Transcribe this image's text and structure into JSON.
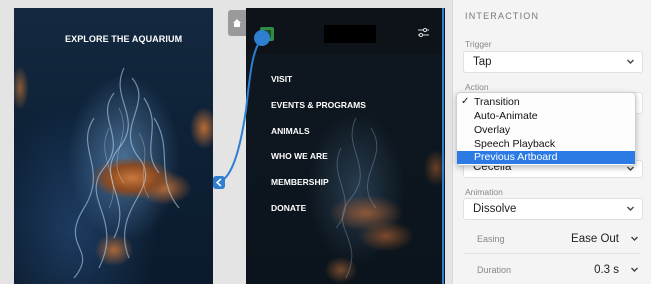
{
  "canvas": {
    "left_artboard": {
      "title": "EXPLORE THE AQUARIUM"
    },
    "right_artboard": {
      "menu": [
        "VISIT",
        "EVENTS & PROGRAMS",
        "ANIMALS",
        "WHO WE ARE",
        "MEMBERSHIP",
        "DONATE"
      ]
    },
    "home_icon": "home-icon",
    "accent_color": "#2f7fd1"
  },
  "panel": {
    "heading": "INTERACTION",
    "trigger": {
      "label": "Trigger",
      "value": "Tap"
    },
    "action": {
      "label": "Action",
      "value": "Transition"
    },
    "destination": {
      "value": "Cecelia"
    },
    "animation": {
      "label": "Animation",
      "value": "Dissolve"
    },
    "easing": {
      "label": "Easing",
      "value": "Ease Out"
    },
    "duration": {
      "label": "Duration",
      "value": "0.3 s"
    }
  },
  "dropdown": {
    "options": [
      "Transition",
      "Auto-Animate",
      "Overlay",
      "Speech Playback",
      "Previous Artboard"
    ],
    "checked": "Transition",
    "highlighted": "Previous Artboard",
    "check_mark": "✓",
    "highlight_color": "#2c7be5"
  }
}
